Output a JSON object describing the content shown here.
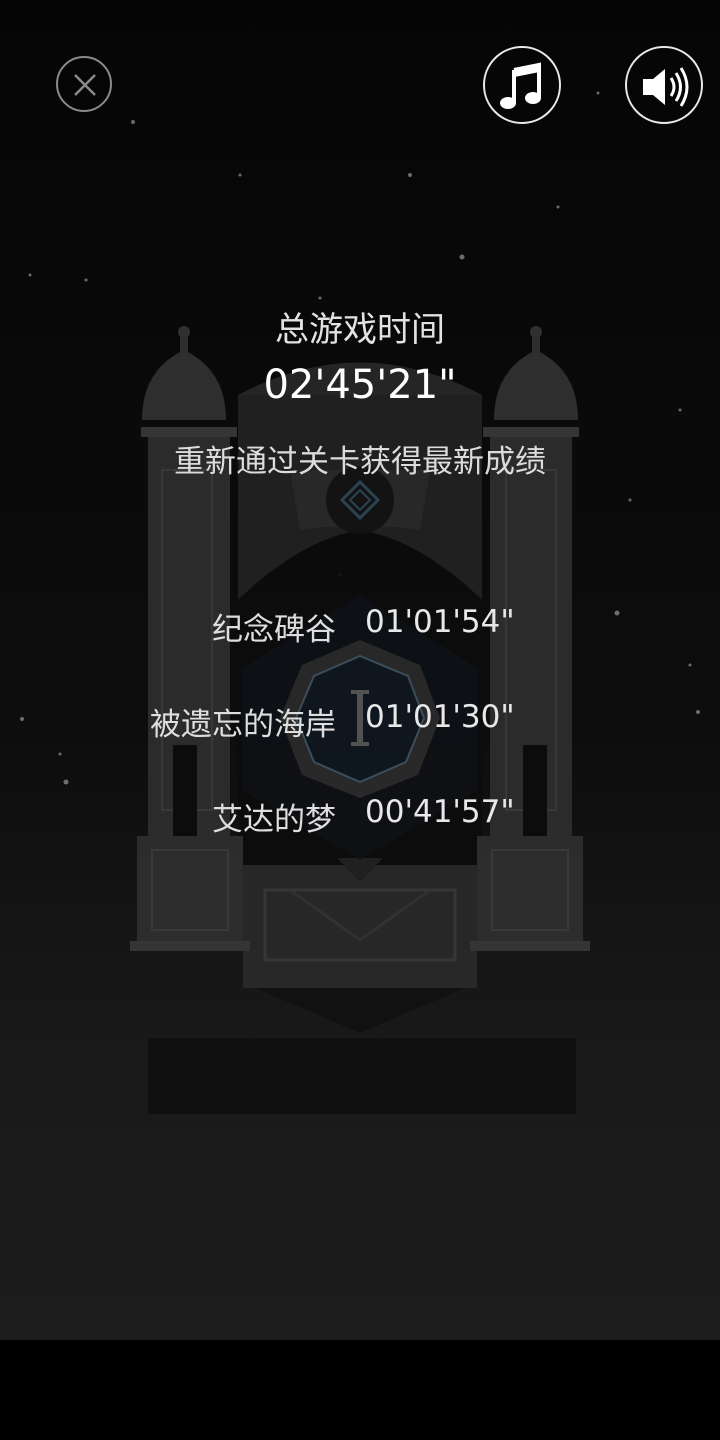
{
  "controls": {
    "close_icon": "close-icon",
    "music_icon": "music-note-icon",
    "sound_icon": "speaker-icon"
  },
  "summary": {
    "title": "总游戏时间",
    "total_time": "02'45'21\"",
    "hint": "重新通过关卡获得最新成绩"
  },
  "chapters": [
    {
      "name": "纪念碑谷",
      "time": "01'01'54\""
    },
    {
      "name": "被遗忘的海岸",
      "time": "01'01'30\""
    },
    {
      "name": "艾达的梦",
      "time": "00'41'57\""
    }
  ],
  "colors": {
    "background": "#050505",
    "text": "#e6e6e6",
    "architecture": "#2e2e2e",
    "accent": "#2f4a5a"
  }
}
